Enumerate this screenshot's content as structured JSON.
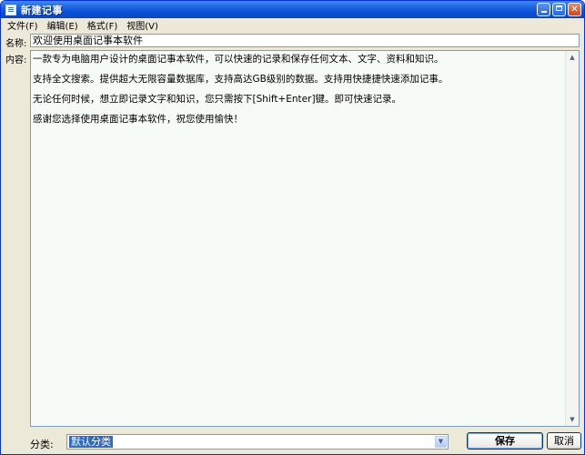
{
  "window": {
    "title": "新建记事"
  },
  "menu": {
    "items": [
      {
        "label": "文件(F)"
      },
      {
        "label": "编辑(E)"
      },
      {
        "label": "格式(F)"
      },
      {
        "label": "视图(V)"
      }
    ]
  },
  "form": {
    "name_label": "名称:",
    "name_value": "欢迎使用桌面记事本软件",
    "content_label": "内容:",
    "content_paragraphs": [
      "一款专为电脑用户设计的桌面记事本软件，可以快速的记录和保存任何文本、文字、资料和知识。",
      "支持全文搜索。提供超大无限容量数据库，支持高达GB级别的数据。支持用快捷捷快速添加记事。",
      "无论任何时候，想立即记录文字和知识，您只需按下[Shift+Enter]键。即可快速记录。",
      "感谢您选择使用桌面记事本软件，祝您使用愉快！"
    ]
  },
  "footer": {
    "category_label": "分类:",
    "category_value": "默认分类",
    "save_label": "保存",
    "cancel_label": "取消"
  },
  "icons": {
    "window": "notepad-icon",
    "minimize": "minimize-icon",
    "maximize": "maximize-icon",
    "close": "close-icon",
    "dropdown": "chevron-down-icon"
  },
  "colors": {
    "titlebar": "#0a50d6",
    "selection": "#316ac5",
    "window_bg": "#ece9d8",
    "content_bg": "#f7fbf7"
  }
}
